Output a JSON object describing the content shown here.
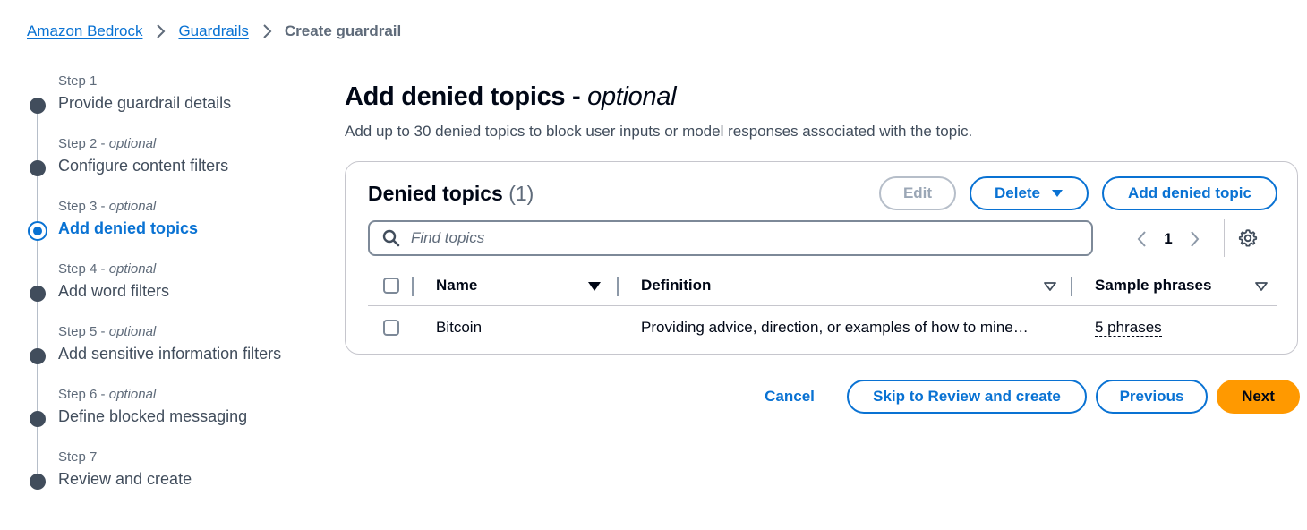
{
  "breadcrumb": {
    "items": [
      "Amazon Bedrock",
      "Guardrails"
    ],
    "current": "Create guardrail"
  },
  "steps": [
    {
      "number": "Step 1",
      "optional": "",
      "label": "Provide guardrail details"
    },
    {
      "number": "Step 2 - ",
      "optional": "optional",
      "label": "Configure content filters"
    },
    {
      "number": "Step 3 - ",
      "optional": "optional",
      "label": "Add denied topics"
    },
    {
      "number": "Step 4 - ",
      "optional": "optional",
      "label": "Add word filters"
    },
    {
      "number": "Step 5 - ",
      "optional": "optional",
      "label": "Add sensitive information filters"
    },
    {
      "number": "Step 6 - ",
      "optional": "optional",
      "label": "Define blocked messaging"
    },
    {
      "number": "Step 7",
      "optional": "",
      "label": "Review and create"
    }
  ],
  "active_step": 3,
  "page": {
    "title": "Add denied topics - ",
    "title_optional": "optional",
    "description": "Add up to 30 denied topics to block user inputs or model responses associated with the topic."
  },
  "container": {
    "title": "Denied topics",
    "count": "(1)",
    "edit_label": "Edit",
    "delete_label": "Delete",
    "add_label": "Add denied topic",
    "search_placeholder": "Find topics",
    "page_number": "1"
  },
  "table": {
    "columns": [
      "Name",
      "Definition",
      "Sample phrases"
    ],
    "rows": [
      {
        "name": "Bitcoin",
        "definition": "Providing advice, direction, or examples of how to mine…",
        "phrases": "5 phrases"
      }
    ]
  },
  "actions": {
    "cancel": "Cancel",
    "skip": "Skip to Review and create",
    "previous": "Previous",
    "next": "Next"
  },
  "colors": {
    "accent": "#0972d3",
    "primary_button": "#ff9900",
    "text": "#000716",
    "muted": "#5f6b7a"
  }
}
